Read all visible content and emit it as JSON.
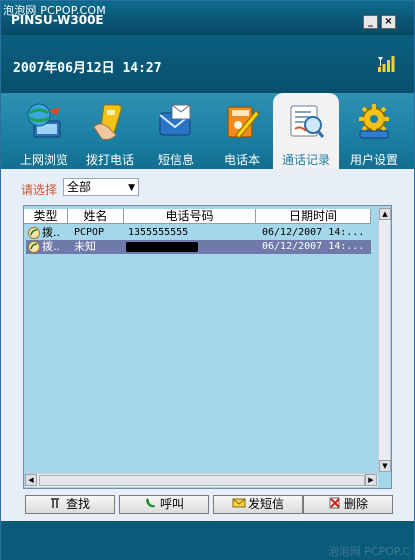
{
  "watermark_top": "泡泡网 PCPOP.COM",
  "app": {
    "title": "PINSU-W300E"
  },
  "titlebar": {
    "minimize_glyph": "_",
    "close_glyph": "×"
  },
  "header": {
    "datetime": "2007年06月12日 14:27",
    "signal_icon": "signal-strength-icon"
  },
  "nav": {
    "items": [
      {
        "label": "上网浏览",
        "icon": "globe-computer-icon"
      },
      {
        "label": "拨打电话",
        "icon": "phone-hand-icon"
      },
      {
        "label": "短信息",
        "icon": "envelope-icon"
      },
      {
        "label": "电话本",
        "icon": "contacts-book-icon"
      },
      {
        "label": "通话记录",
        "icon": "call-log-icon",
        "active": true
      },
      {
        "label": "用户设置",
        "icon": "settings-gear-icon"
      }
    ]
  },
  "filter": {
    "label": "请选择",
    "selected": "全部"
  },
  "list": {
    "columns": [
      "类型",
      "姓名",
      "电话号码",
      "日期时间"
    ],
    "rows": [
      {
        "type": "拨..",
        "name": "PCPOP",
        "phone": "1355555555",
        "datetime": "06/12/2007 14:..."
      },
      {
        "type": "拨..",
        "name": "未知",
        "phone": "",
        "datetime": "06/12/2007 14:...",
        "selected": true
      }
    ]
  },
  "actions": {
    "find": "查找",
    "call": "呼叫",
    "sms": "发短信",
    "delete": "删除"
  },
  "watermark_bottom": "泡泡网 PCPOP.C",
  "colors": {
    "accent": "#1a7fa2",
    "selected_row": "#6f79aa",
    "list_bg": "#a5d7ea",
    "filter_label": "#d1542e"
  }
}
